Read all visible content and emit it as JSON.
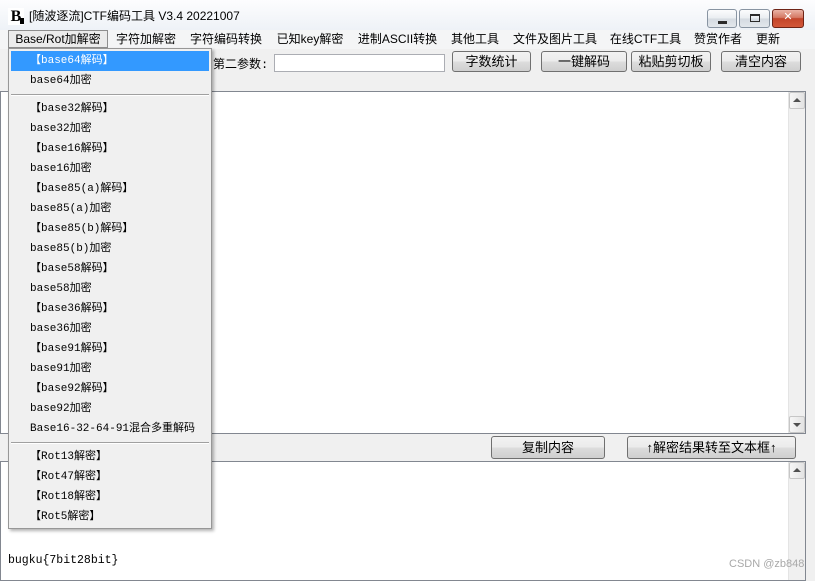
{
  "window": {
    "title": "[随波逐流]CTF编码工具 V3.4 20221007",
    "icon_text": "B"
  },
  "icons": {
    "app": "app-logo-icon",
    "minimize": "minimize-icon",
    "maximize": "maximize-icon",
    "close": "close-icon",
    "scroll_up": "arrow-up-icon",
    "scroll_down": "arrow-down-icon"
  },
  "colors": {
    "menu_highlight": "#3399ff",
    "menu_highlight_text": "#ffffff",
    "close_button": "#c2452b",
    "window_background": "#f0f0f0",
    "textbox_background": "#ffffff",
    "watermark": "#a8a8a8"
  },
  "menubar": {
    "items": [
      {
        "label": "Base/Rot加解密",
        "open": true
      },
      {
        "label": "字符加解密",
        "open": false
      },
      {
        "label": "字符编码转换",
        "open": false
      },
      {
        "label": "已知key解密",
        "open": false
      },
      {
        "label": "进制ASCII转换",
        "open": false
      },
      {
        "label": "其他工具",
        "open": false
      },
      {
        "label": "文件及图片工具",
        "open": false
      },
      {
        "label": "在线CTF工具",
        "open": false
      },
      {
        "label": "赞赏作者",
        "open": false
      },
      {
        "label": "更新",
        "open": false
      }
    ]
  },
  "dropdown": {
    "highlighted": {
      "group": 0,
      "item": 0
    },
    "groups": [
      [
        "【base64解码】",
        "base64加密"
      ],
      [
        "【base32解码】",
        "base32加密",
        "【base16解码】",
        "base16加密",
        "【base85(a)解码】",
        "base85(a)加密",
        "【base85(b)解码】",
        "base85(b)加密",
        "【base58解码】",
        "base58加密",
        "【base36解码】",
        "base36加密",
        "【base91解码】",
        "base91加密",
        "【base92解码】",
        "base92加密",
        "Base16-32-64-91混合多重解码"
      ],
      [
        "【Rot13解密】",
        "【Rot47解密】",
        "【Rot18解密】",
        "【Rot5解密】"
      ]
    ]
  },
  "toolbar": {
    "param_label": "第二参数:",
    "param_value": "",
    "buttons": {
      "count": "字数统计",
      "decode_all": "一键解码",
      "paste": "粘贴剪切板",
      "clear": "清空内容"
    }
  },
  "input_area": {
    "text": ""
  },
  "action_bar": {
    "copy": "复制内容",
    "transfer": "↑解密结果转至文本框↑"
  },
  "output_area": {
    "text": "bugku{7bit28bit}"
  },
  "watermark": "CSDN @zb848"
}
